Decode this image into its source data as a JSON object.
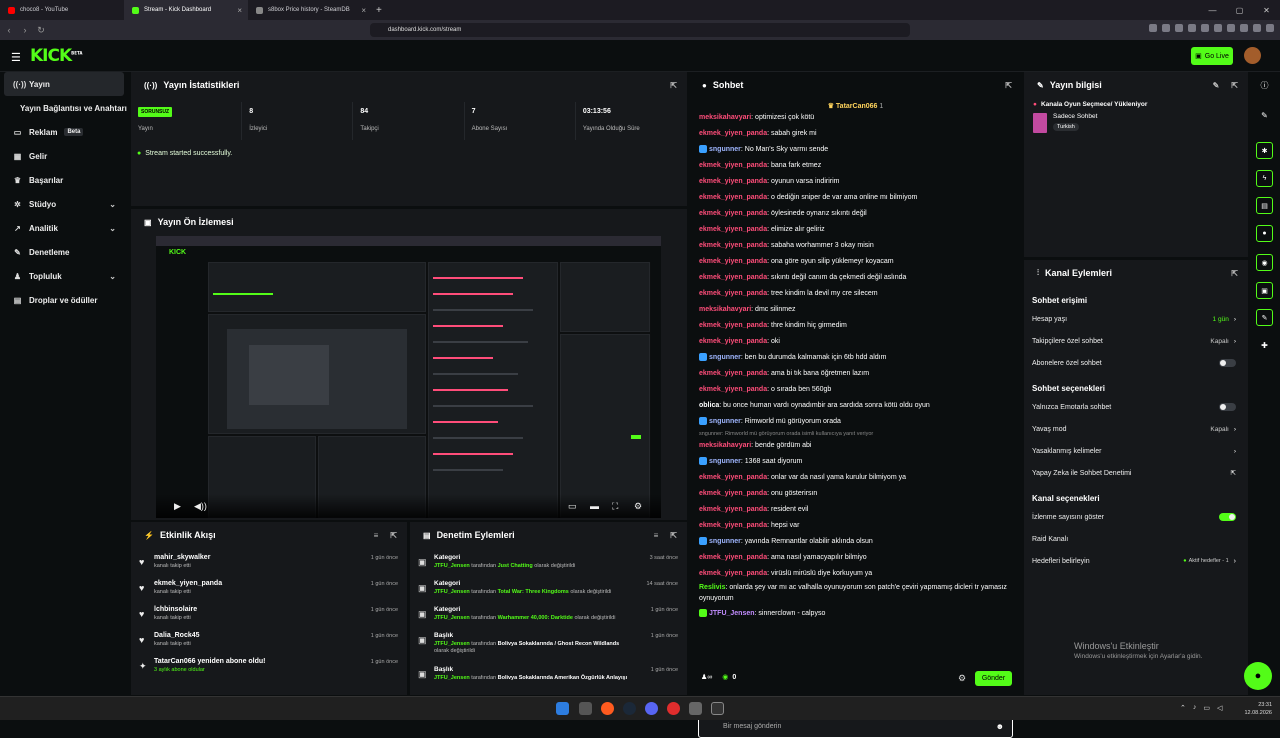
{
  "browser": {
    "tabs": [
      {
        "label": "choco8 - YouTube",
        "color": "#ff0000"
      },
      {
        "label": "Stream - Kick Dashboard",
        "color": "#53fc18"
      },
      {
        "label": "s8box Price history - SteamDB",
        "color": "#888888"
      }
    ],
    "url": "dashboard.kick.com/stream"
  },
  "topbar": {
    "logo": "KICK",
    "logo_sup": "BETA",
    "golive": "Go Live"
  },
  "sidebar": {
    "items": [
      {
        "label": "Yayın",
        "icon": "broadcast-icon"
      },
      {
        "label": "Yayın Bağlantısı ve Anahtarı",
        "icon": ""
      },
      {
        "label": "Reklam",
        "icon": "ad-icon",
        "badge": "Beta"
      },
      {
        "label": "Gelir",
        "icon": "money-icon"
      },
      {
        "label": "Başarılar",
        "icon": "trophy-icon"
      },
      {
        "label": "Stüdyo",
        "icon": "studio-icon"
      },
      {
        "label": "Analitik",
        "icon": "chart-icon"
      },
      {
        "label": "Denetleme",
        "icon": "wrench-icon"
      },
      {
        "label": "Topluluk",
        "icon": "community-icon"
      },
      {
        "label": "Droplar ve ödüller",
        "icon": "gift-icon"
      }
    ]
  },
  "stats": {
    "title": "Yayın İstatistikleri",
    "items": [
      {
        "value": "SORUNSUZ",
        "label": "Yayın"
      },
      {
        "value": "8",
        "label": "İzleyici"
      },
      {
        "value": "84",
        "label": "Takipçi"
      },
      {
        "value": "7",
        "label": "Abone Sayısı"
      },
      {
        "value": "03:13:56",
        "label": "Yayında Olduğu Süre"
      }
    ],
    "success": "Stream started successfully."
  },
  "preview": {
    "title": "Yayın Ön İzlemesi"
  },
  "activity": {
    "title": "Etkinlik Akışı",
    "items": [
      {
        "name": "mahir_skywalker",
        "sub": "kanalı takip etti",
        "time": "1 gün önce"
      },
      {
        "name": "ekmek_yiyen_panda",
        "sub": "kanalı takip etti",
        "time": "1 gün önce"
      },
      {
        "name": "lchbinsolaire",
        "sub": "kanalı takip etti",
        "time": "1 gün önce"
      },
      {
        "name": "Dalia_Rock45",
        "sub": "kanalı takip etti",
        "time": "1 gün önce"
      },
      {
        "name": "TatarCan066 yeniden abone oldu!",
        "sub": "3 aylık abone oldular",
        "time": "1 gün önce"
      }
    ]
  },
  "moderation": {
    "title": "Denetim Eylemleri",
    "items": [
      {
        "type": "Kategori",
        "user": "JTFU_Jensen",
        "mid": "tarafından",
        "target": "Just Chatting",
        "end": "olarak değiştirildi",
        "time": "3 saat önce"
      },
      {
        "type": "Kategori",
        "user": "JTFU_Jensen",
        "mid": "tarafından",
        "target": "Total War: Three Kingdoms",
        "end": "olarak değiştirildi",
        "time": "14 saat önce"
      },
      {
        "type": "Kategori",
        "user": "JTFU_Jensen",
        "mid": "tarafından",
        "target": "Warhammer 40,000: Darktide",
        "end": "olarak değiştirildi",
        "time": "1 gün önce"
      },
      {
        "type": "Başlık",
        "user": "JTFU_Jensen",
        "mid": "tarafından",
        "target": "Bolivya Sokaklarında / Ghost Recon Wildlands",
        "end": "olarak değiştirildi",
        "time": "1 gün önce"
      },
      {
        "type": "Başlık",
        "user": "JTFU_Jensen",
        "mid": "tarafından",
        "target": "Bolivya Sokaklarında Amerikan Özgürlük Anlayışı",
        "end": "",
        "time": "1 gün önce"
      }
    ]
  },
  "chat": {
    "title": "Sohbet",
    "pinned": "TatarCan066",
    "pinned_count": "1",
    "messages": [
      {
        "user": "meksikahavyari",
        "text": "optimizesi çok kötü",
        "cls": "u"
      },
      {
        "user": "ekmek_yiyen_panda",
        "text": "sabah girek mi",
        "cls": "u"
      },
      {
        "user": "sngunner",
        "text": "No Man's Sky varmı sende",
        "cls": "u2"
      },
      {
        "user": "ekmek_yiyen_panda",
        "text": "bana fark etmez",
        "cls": "u"
      },
      {
        "user": "ekmek_yiyen_panda",
        "text": "oyunun varsa indiririm",
        "cls": "u"
      },
      {
        "user": "ekmek_yiyen_panda",
        "text": "o dediğin sniper de var ama online mı bilmiyom",
        "cls": "u"
      },
      {
        "user": "ekmek_yiyen_panda",
        "text": "öylesinede oynarız sıkıntı değil",
        "cls": "u"
      },
      {
        "user": "ekmek_yiyen_panda",
        "text": "elimize alır geliriz",
        "cls": "u"
      },
      {
        "user": "ekmek_yiyen_panda",
        "text": "sabaha worhammer 3 okay misin",
        "cls": "u"
      },
      {
        "user": "ekmek_yiyen_panda",
        "text": "ona göre oyun silip yüklemeyr koyacam",
        "cls": "u"
      },
      {
        "user": "ekmek_yiyen_panda",
        "text": "sıkıntı değil canım da çekmedi değil aslında",
        "cls": "u"
      },
      {
        "user": "ekmek_yiyen_panda",
        "text": "tree kindim la devil my cre silecem",
        "cls": "u"
      },
      {
        "user": "meksikahavyari",
        "text": "dmc silinmez",
        "cls": "u"
      },
      {
        "user": "ekmek_yiyen_panda",
        "text": "thre kindim hiç girmedim",
        "cls": "u"
      },
      {
        "user": "ekmek_yiyen_panda",
        "text": "oki",
        "cls": "u"
      },
      {
        "user": "sngunner",
        "text": "ben bu durumda kalmamak için 6tb hdd aldım",
        "cls": "u2"
      },
      {
        "user": "ekmek_yiyen_panda",
        "text": "ama bi tık bana öğretmen lazım",
        "cls": "u"
      },
      {
        "user": "ekmek_yiyen_panda",
        "text": "o sırada ben 560gb",
        "cls": "u"
      },
      {
        "user": "oblica",
        "text": "bu once human vardı oynadımbir ara sardıda sonra kötü oldu oyun",
        "cls": "u3"
      },
      {
        "user": "sngunner",
        "text": "Rimworld mü görüyorum orada",
        "cls": "u2"
      },
      {
        "reply": "sngunner: Rimworld mü görüyorum orada isimli kullanıcıya yanıt veriyor",
        "user": "meksikahavyari",
        "text": "bende gördüm abi",
        "cls": "u"
      },
      {
        "user": "sngunner",
        "text": "1368 saat diyorum",
        "cls": "u2"
      },
      {
        "user": "ekmek_yiyen_panda",
        "text": "onlar var da nasıl yama kurulur bilmiyom ya",
        "cls": "u"
      },
      {
        "user": "ekmek_yiyen_panda",
        "text": "onu gösterirsın",
        "cls": "u"
      },
      {
        "user": "ekmek_yiyen_panda",
        "text": "resident evil",
        "cls": "u"
      },
      {
        "user": "ekmek_yiyen_panda",
        "text": "hepsi var",
        "cls": "u"
      },
      {
        "user": "sngunner",
        "text": "yavında Remnantlar olabilir aklında olsun",
        "cls": "u2"
      },
      {
        "user": "ekmek_yiyen_panda",
        "text": "ama nasıl yamacyapılır bilmiyo",
        "cls": "u"
      },
      {
        "user": "ekmek_yiyen_panda",
        "text": "virüslü mirüslü diye korkuyum ya",
        "cls": "u"
      },
      {
        "user": "Reslivis",
        "text": "onlarda şey var mı ac valhalla oyunuyorum son patch'e çeviri yapmamış dicleri tr yamasız oynuyorum",
        "cls": "u4",
        "two": true
      },
      {
        "user": "JTFU_Jensen",
        "text": "sinnerclown - calpyso",
        "cls": "u5"
      }
    ],
    "input_placeholder": "Bir mesaj gönderin",
    "points": "0",
    "send": "Gönder"
  },
  "info": {
    "title": "Yayın bilgisi",
    "category": "Kanala Oyun Seçmece/ Yükleniyor",
    "sub": "Sadece Sohbet",
    "lang": "Turkish"
  },
  "channel": {
    "title": "Kanal Eylemleri",
    "sec1": "Sohbet erişimi",
    "s1": [
      {
        "label": "Hesap yaşı",
        "value": "1 gün",
        "kind": "chev-green"
      },
      {
        "label": "Takipçilere özel sohbet",
        "value": "Kapalı",
        "kind": "chev"
      },
      {
        "label": "Abonelere özel sohbet",
        "value": "",
        "kind": "toggle-off"
      }
    ],
    "sec2": "Sohbet seçenekleri",
    "s2": [
      {
        "label": "Yalnızca Emotarla sohbet",
        "value": "",
        "kind": "toggle-off"
      },
      {
        "label": "Yavaş mod",
        "value": "Kapalı",
        "kind": "chev"
      },
      {
        "label": "Yasaklanmış kelimeler",
        "value": "",
        "kind": "chev"
      },
      {
        "label": "Yapay Zeka ile Sohbet Denetimi",
        "value": "",
        "kind": "ext"
      }
    ],
    "sec3": "Kanal seçenekleri",
    "s3": [
      {
        "label": "İzlenme sayısını göster",
        "value": "",
        "kind": "toggle-on"
      },
      {
        "label": "Raid Kanalı",
        "value": "",
        "kind": "none"
      },
      {
        "label": "Hedefleri belirleyin",
        "value": "Aktif hedefler - 1",
        "kind": "chev-dot"
      }
    ]
  },
  "watermark": {
    "title": "Windows'u Etkinleştir",
    "sub": "Windows'u etkinleştirmek için Ayarlar'a gidin."
  },
  "tray": {
    "time": "23:31",
    "date": "12.08.2026"
  }
}
